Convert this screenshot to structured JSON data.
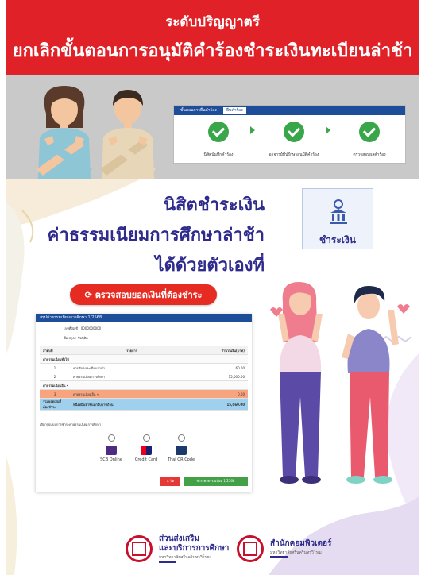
{
  "header": {
    "subtitle": "ระดับปริญญาตรี",
    "title": "ยกเลิกขั้นตอนการอนุมัติคำร้องชำระเงินทะเบียนล่าช้า",
    "color": "#e12128"
  },
  "steps_card": {
    "header_label": "ขั้นตอนการยื่นคำร้อง",
    "tab_label": "ยื่นคำร้อง",
    "steps": [
      {
        "label": "นิสิตบันทึกคำร้อง"
      },
      {
        "label": "อาจารย์ที่ปรึกษาอนุมัติคำร้อง"
      },
      {
        "label": "ตรวจสอบผลคำร้อง"
      }
    ]
  },
  "promo": {
    "line1": "นิสิตชำระเงิน",
    "line2": "ค่าธรรมเนียมการศึกษาล่าช้า",
    "line3": "ได้ด้วยตัวเองที่",
    "pay_tile_label": "ชำระเงิน",
    "check_button": "ตรวจสอบยอดเงินที่ต้องชำระ",
    "text_color": "#2e2b8c"
  },
  "invoice": {
    "header": "สรุปค่าธรรมเนียมการศึกษา 1/2568",
    "student_id_label": "เลขที่บัญชี :",
    "student_id": "0000000000",
    "name_label": "ชื่อ-สกุล :",
    "name": "ชื่อนิสิต",
    "columns": [
      "ลำดับที่",
      "รายการ",
      "จำนวนเงิน(บาท)"
    ],
    "sections": [
      {
        "title": "ค่าธรรมเนียมทั่วไป",
        "rows": [
          {
            "no": "1",
            "item": "ค่าปรับลงทะเบียนล่าช้า",
            "amount": "60.00"
          },
          {
            "no": "2",
            "item": "ค่าธรรมเนียมการศึกษา",
            "amount": "15,000.00"
          }
        ]
      },
      {
        "title": "ค่าธรรมเนียมอื่น ๆ",
        "rows": [
          {
            "no": "3",
            "item": "ค่าธรรมเนียมอื่น ๆ",
            "amount": "0.00"
          }
        ]
      }
    ],
    "total_label": "รวมยอดเงินที่ต้องชำระ",
    "total_item": "หนึ่งหมื่นห้าพันหกสิบบาทถ้วน",
    "total_amount": "15,060.00",
    "payment_note": "เลือกรูปแบบการชำระค่าธรรมเนียมการศึกษา",
    "methods": [
      "SCB Online",
      "Credit Card",
      "Thai QR Code"
    ],
    "cancel_button": "✕ ปิด",
    "pay_button": "ชำระค่าธรรมเนียม 1/2568"
  },
  "footer": {
    "org1_line1": "ส่วนส่งเสริม",
    "org1_line2": "และบริการการศึกษา",
    "org1_sub": "มหาวิทยาลัยศรีนครินทรวิโรฒ",
    "org2_line1": "สำนักคอมพิวเตอร์",
    "org2_sub": "มหาวิทยาลัยศรีนครินทรวิโรฒ"
  }
}
